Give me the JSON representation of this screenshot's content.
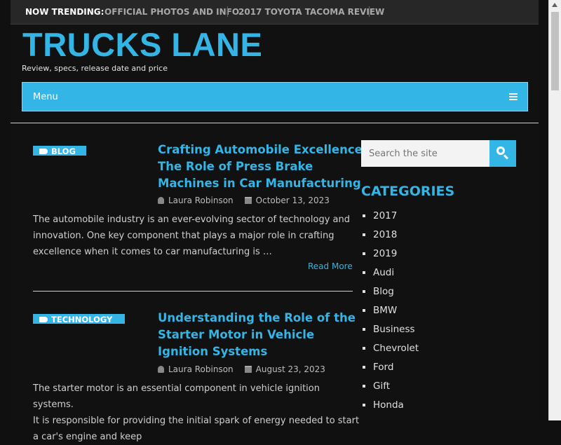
{
  "trending": {
    "label": "NOW TRENDING:",
    "items": [
      "OFFICIAL PHOTOS AND INFO",
      "2017 TOYOTA TACOMA REVIEW"
    ]
  },
  "site": {
    "title": "TRUCKS LANE",
    "description": "Review, specs, release date and price"
  },
  "menu": {
    "label": "Menu"
  },
  "posts": [
    {
      "category": "BLOG",
      "title_lines": [
        "Crafting Automobile Excellence:",
        "The Role of Press Brake",
        "Machines in Car Manufacturing"
      ],
      "author": "Laura Robinson",
      "date": "October 13, 2023",
      "excerpt_lines": [
        "The automobile industry is an ever-evolving sector of technology and",
        "innovation. One key component that plays a major role in crafting",
        "excellence when it comes to car manufacturing is …"
      ],
      "read_more": "Read More"
    },
    {
      "category": "TECHNOLOGY",
      "title_lines": [
        "Understanding the Role of the",
        "Starter Motor in Vehicle",
        "Ignition Systems"
      ],
      "author": "Laura Robinson",
      "date": "August 23, 2023",
      "excerpt_lines": [
        "The starter motor is an essential component in vehicle ignition systems.",
        "It is responsible for providing the initial spark of energy needed to start",
        "a car's engine and keep"
      ]
    }
  ],
  "sidebar": {
    "search_placeholder": "Search the site",
    "categories_heading": "CATEGORIES",
    "categories": [
      "2017",
      "2018",
      "2019",
      "Audi",
      "Blog",
      "BMW",
      "Business",
      "Chevrolet",
      "Ford",
      "Gift",
      "Honda"
    ]
  },
  "colors": {
    "accent": "#33b5e5",
    "background": "#111111",
    "trending_bar": "#272727"
  }
}
